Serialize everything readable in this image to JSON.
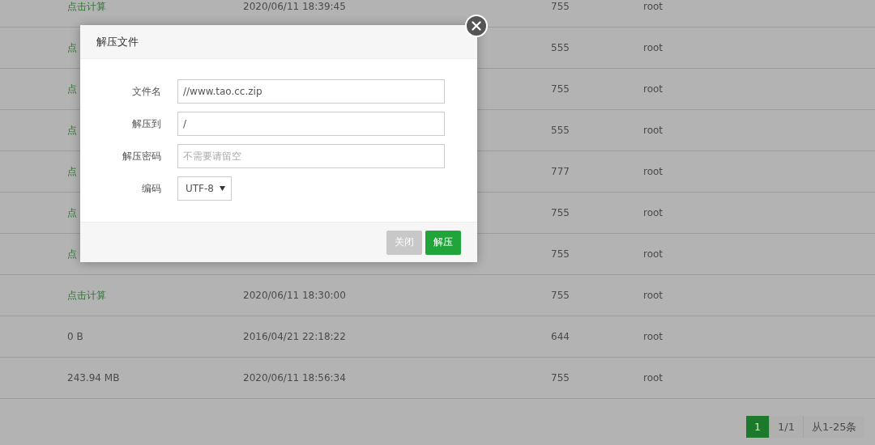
{
  "table": {
    "rows": [
      {
        "size": {
          "text": "点击计算",
          "kind": "link"
        },
        "date": "2020/06/11 18:39:45",
        "permission": "755",
        "owner": "root"
      },
      {
        "size": {
          "text": "点",
          "kind": "link"
        },
        "permission": "555",
        "owner": "root"
      },
      {
        "size": {
          "text": "点",
          "kind": "link"
        },
        "permission": "755",
        "owner": "root"
      },
      {
        "size": {
          "text": "点",
          "kind": "link"
        },
        "permission": "555",
        "owner": "root"
      },
      {
        "size": {
          "text": "点",
          "kind": "link"
        },
        "permission": "777",
        "owner": "root"
      },
      {
        "size": {
          "text": "点",
          "kind": "link"
        },
        "permission": "755",
        "owner": "root"
      },
      {
        "size": {
          "text": "点",
          "kind": "link"
        },
        "permission": "755",
        "owner": "root"
      },
      {
        "size": {
          "text": "点击计算",
          "kind": "link"
        },
        "date": "2020/06/11 18:30:00",
        "permission": "755",
        "owner": "root"
      },
      {
        "size": {
          "text": "0 B",
          "kind": "plain"
        },
        "date": "2016/04/21 22:18:22",
        "permission": "644",
        "owner": "root"
      },
      {
        "size": {
          "text": "243.94 MB",
          "kind": "plain"
        },
        "date": "2020/06/11 18:56:34",
        "permission": "755",
        "owner": "root"
      }
    ]
  },
  "pagination": {
    "pages": [
      {
        "label": "1",
        "selected": true
      }
    ],
    "info": [
      "1/1",
      "从1-25条"
    ]
  },
  "dialog": {
    "title": "解压文件",
    "fields": [
      {
        "label": "文件名",
        "kind": "text",
        "value": "//www.tao.cc.zip"
      },
      {
        "label": "解压到",
        "kind": "text",
        "value": "/"
      },
      {
        "label": "解压密码",
        "kind": "text",
        "placeholder": "不需要请留空"
      },
      {
        "label": "编码",
        "kind": "select",
        "value": "UTF-8"
      }
    ],
    "buttons": [
      {
        "label": "关闭",
        "kind": "secondary"
      },
      {
        "label": "解压",
        "kind": "primary"
      }
    ]
  }
}
